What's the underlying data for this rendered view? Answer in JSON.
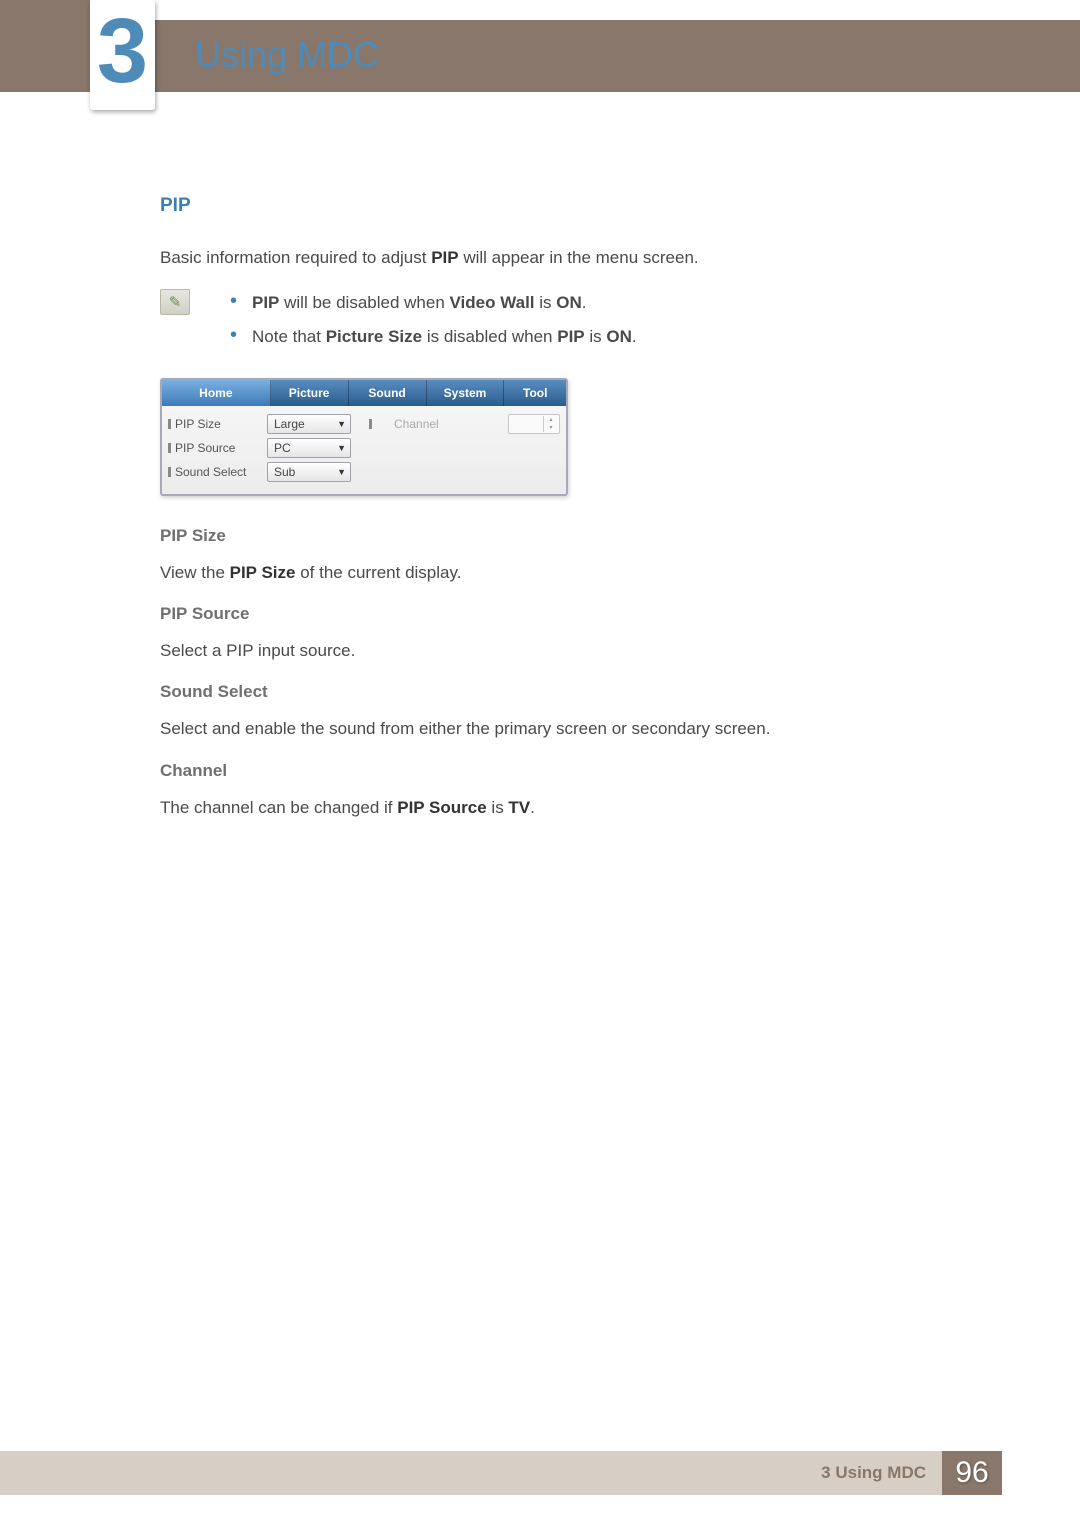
{
  "chapter": {
    "number": "3",
    "title": "Using MDC"
  },
  "section": {
    "heading": "PIP",
    "intro": {
      "pre": "Basic information required to adjust ",
      "bold1": "PIP",
      "post": " will appear in the menu screen."
    },
    "notes": [
      {
        "b1": "PIP",
        "t1": " will be disabled when ",
        "b2": "Video Wall",
        "t2": " is ",
        "b3": "ON",
        "t3": "."
      },
      {
        "t0": "Note that ",
        "b1": "Picture Size",
        "t1": " is disabled when ",
        "b2": "PIP",
        "t2": " is ",
        "b3": "ON",
        "t3": "."
      }
    ],
    "ui": {
      "tabs": [
        "Home",
        "Picture",
        "Sound",
        "System",
        "Tool"
      ],
      "rows": [
        {
          "label": "PIP Size",
          "value": "Large"
        },
        {
          "label": "PIP Source",
          "value": "PC"
        },
        {
          "label": "Sound Select",
          "value": "Sub"
        }
      ],
      "channel_label": "Channel"
    },
    "subsections": [
      {
        "title": "PIP Size",
        "line": {
          "pre": "View the ",
          "b1": "PIP Size",
          "post": " of the current display."
        }
      },
      {
        "title": "PIP Source",
        "line": {
          "pre": "Select a PIP input source.",
          "b1": "",
          "post": ""
        }
      },
      {
        "title": "Sound Select",
        "line": {
          "pre": "Select and enable the sound from either the primary screen or secondary screen.",
          "b1": "",
          "post": ""
        }
      },
      {
        "title": "Channel",
        "line": {
          "pre": "The channel can be changed if ",
          "b1": "PIP Source",
          "mid": " is ",
          "b2": "TV",
          "post": "."
        }
      }
    ]
  },
  "footer": {
    "label": "3 Using MDC",
    "page": "96"
  }
}
